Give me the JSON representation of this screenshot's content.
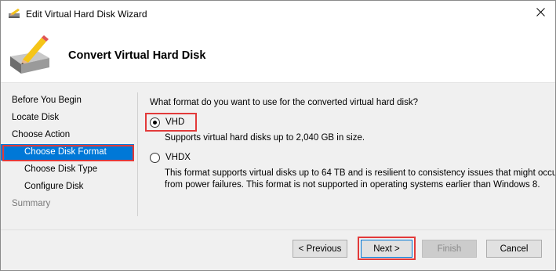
{
  "window": {
    "title": "Edit Virtual Hard Disk Wizard",
    "close_symbol": "✕"
  },
  "header": {
    "title": "Convert Virtual Hard Disk",
    "icon": "hard-disk-pencil-icon"
  },
  "nav": {
    "items": [
      {
        "label": "Before You Begin",
        "level": 0,
        "state": "normal"
      },
      {
        "label": "Locate Disk",
        "level": 0,
        "state": "normal"
      },
      {
        "label": "Choose Action",
        "level": 0,
        "state": "normal"
      },
      {
        "label": "Choose Disk Format",
        "level": 1,
        "state": "selected"
      },
      {
        "label": "Choose Disk Type",
        "level": 1,
        "state": "normal"
      },
      {
        "label": "Configure Disk",
        "level": 1,
        "state": "normal"
      },
      {
        "label": "Summary",
        "level": 0,
        "state": "disabled"
      }
    ]
  },
  "content": {
    "question": "What format do you want to use for the converted virtual hard disk?",
    "options": [
      {
        "label": "VHD",
        "checked": true,
        "description": "Supports virtual hard disks up to 2,040 GB in size."
      },
      {
        "label": "VHDX",
        "checked": false,
        "description_line1": "This format supports virtual disks up to 64 TB and is resilient to consistency issues that might occur",
        "description_line2": "from power failures. This format is not supported in operating systems earlier than Windows 8."
      }
    ]
  },
  "footer": {
    "previous_label": "< Previous",
    "next_label": "Next >",
    "finish_label": "Finish",
    "cancel_label": "Cancel"
  },
  "colors": {
    "selection": "#0078d7",
    "highlight_box": "#e23a3a",
    "dialog_background": "#f0f0f0"
  }
}
